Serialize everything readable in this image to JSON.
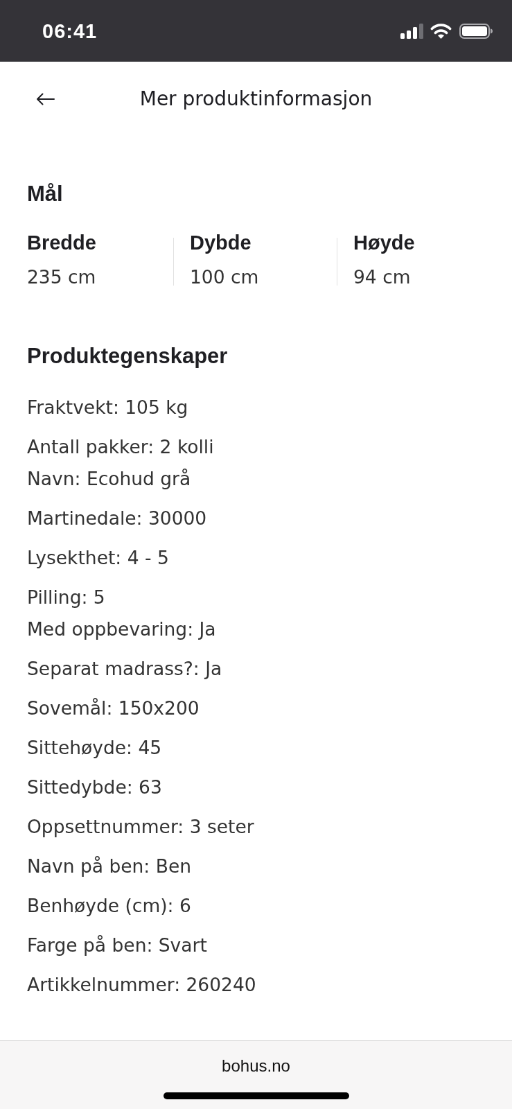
{
  "status_bar": {
    "time": "06:41"
  },
  "header": {
    "title": "Mer produktinformasjon"
  },
  "dimensions": {
    "title": "Mål",
    "items": [
      {
        "label": "Bredde",
        "value": "235 cm"
      },
      {
        "label": "Dybde",
        "value": "100 cm"
      },
      {
        "label": "Høyde",
        "value": "94 cm"
      }
    ]
  },
  "properties": {
    "title": "Produktegenskaper",
    "groups": [
      {
        "lines": [
          "Fraktvekt: 105 kg"
        ]
      },
      {
        "lines": [
          "Antall pakker: 2 kolli",
          "Navn: Ecohud grå"
        ]
      },
      {
        "lines": [
          "Martinedale: 30000"
        ]
      },
      {
        "lines": [
          "Lysekthet: 4 - 5"
        ]
      },
      {
        "lines": [
          "Pilling: 5",
          "Med oppbevaring: Ja"
        ]
      },
      {
        "lines": [
          "Separat madrass?: Ja"
        ]
      },
      {
        "lines": [
          "Sovemål: 150x200"
        ]
      },
      {
        "lines": [
          "Sittehøyde: 45"
        ]
      },
      {
        "lines": [
          "Sittedybde: 63"
        ]
      },
      {
        "lines": [
          "Oppsettnummer: 3 seter"
        ]
      },
      {
        "lines": [
          "Navn på ben: Ben"
        ]
      },
      {
        "lines": [
          "Benhøyde (cm): 6"
        ]
      },
      {
        "lines": [
          "Farge på ben: Svart"
        ]
      },
      {
        "lines": [
          "Artikkelnummer: 260240"
        ]
      }
    ]
  },
  "footer": {
    "domain": "bohus.no"
  }
}
